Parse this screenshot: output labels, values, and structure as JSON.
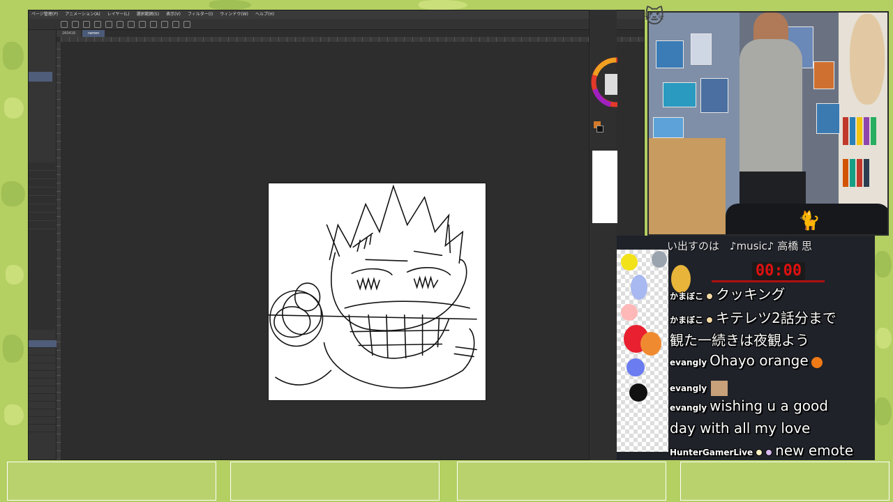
{
  "menubar": {
    "items": [
      "ページ管理(P)",
      "アニメーション(A)",
      "レイヤー(L)",
      "選択範囲(S)",
      "表示(V)",
      "フィルター(I)",
      "ウィンドウ(W)",
      "ヘルプ(H)"
    ]
  },
  "tabs": [
    {
      "label": "260418"
    },
    {
      "label": "ramen"
    }
  ],
  "stream": {
    "song_title": "い出すのは　♪music♪ 高橋 思",
    "timer": "00:00"
  },
  "chat": [
    {
      "user": "かまぼこ",
      "message": "クッキング"
    },
    {
      "user": "かまぼこ",
      "message": "キテレツ2話分まで"
    },
    {
      "user": "",
      "message": "観た一続きは夜観よう"
    },
    {
      "user": "evangly",
      "message": "Ohayo orange"
    },
    {
      "user": "evangly",
      "message": ""
    },
    {
      "user": "evangly",
      "message": "wishing u a good"
    },
    {
      "user": "",
      "message": "day with all my love"
    },
    {
      "user": "HunterGamerLive",
      "message": "new emote"
    }
  ],
  "colors": {
    "accent_selection": "#4f5d7b",
    "timer_red": "#e01010",
    "background_green": "#b4cf62"
  }
}
